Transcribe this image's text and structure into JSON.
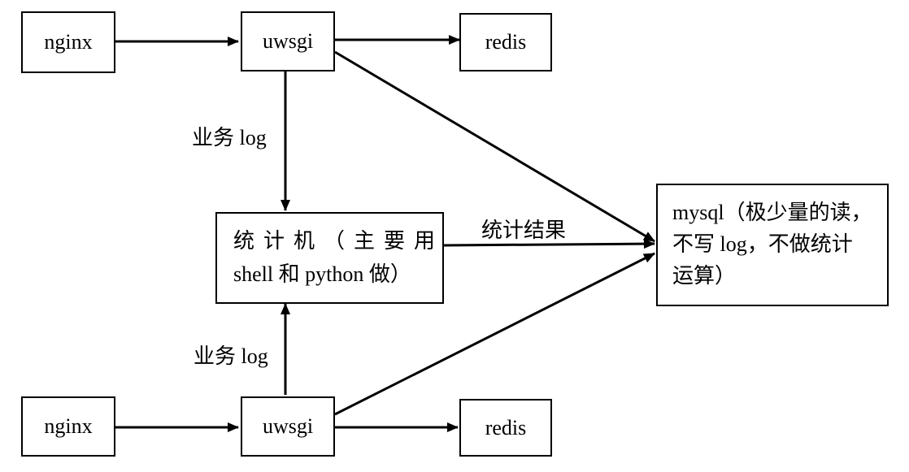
{
  "nodes": {
    "nginx_top": "nginx",
    "uwsgi_top": "uwsgi",
    "redis_top": "redis",
    "stats": {
      "line1": "统计机（主要用",
      "line2": "shell 和 python 做）"
    },
    "mysql": {
      "line1": "mysql（极少量的读，",
      "line2": "不写 log，不做统计",
      "line3": "运算）"
    },
    "nginx_bottom": "nginx",
    "uwsgi_bottom": "uwsgi",
    "redis_bottom": "redis"
  },
  "edge_labels": {
    "business_log_top": "业务 log",
    "business_log_bottom": "业务 log",
    "stats_result": "统计结果"
  }
}
